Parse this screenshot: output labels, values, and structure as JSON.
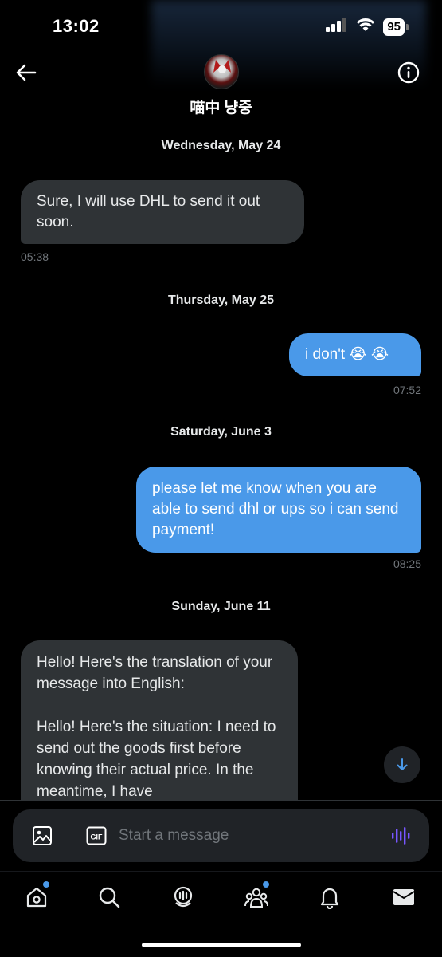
{
  "status_bar": {
    "time": "13:02",
    "battery": "95"
  },
  "header": {
    "contact_name": "喵中 냥중"
  },
  "conversation": [
    {
      "type": "date",
      "label": "Wednesday, May 24"
    },
    {
      "type": "incoming",
      "text": "Sure, I will use DHL to send it out soon.",
      "time": "05:38"
    },
    {
      "type": "date",
      "label": "Thursday, May 25"
    },
    {
      "type": "outgoing",
      "text": "i don't 😭 😭",
      "time": "07:52"
    },
    {
      "type": "date",
      "label": "Saturday, June 3"
    },
    {
      "type": "outgoing",
      "text": "please let me know when you are able to send dhl or ups so i can send payment!",
      "time": "08:25"
    },
    {
      "type": "date",
      "label": "Sunday, June 11"
    },
    {
      "type": "incoming",
      "text": "Hello! Here's the translation of your message into English:\n\nHello! Here's the situation: I need to send out the goods first before knowing their actual price. In the meantime, I have"
    }
  ],
  "composer": {
    "placeholder": "Start a message",
    "gif_label": "GIF"
  },
  "nav": {
    "items": [
      "home-icon",
      "search-icon",
      "spaces-icon",
      "communities-icon",
      "notifications-icon",
      "messages-icon"
    ]
  },
  "colors": {
    "accent": "#4a99e9",
    "incoming_bubble": "#2f3336",
    "background": "#000000",
    "voice": "#7856ff"
  }
}
